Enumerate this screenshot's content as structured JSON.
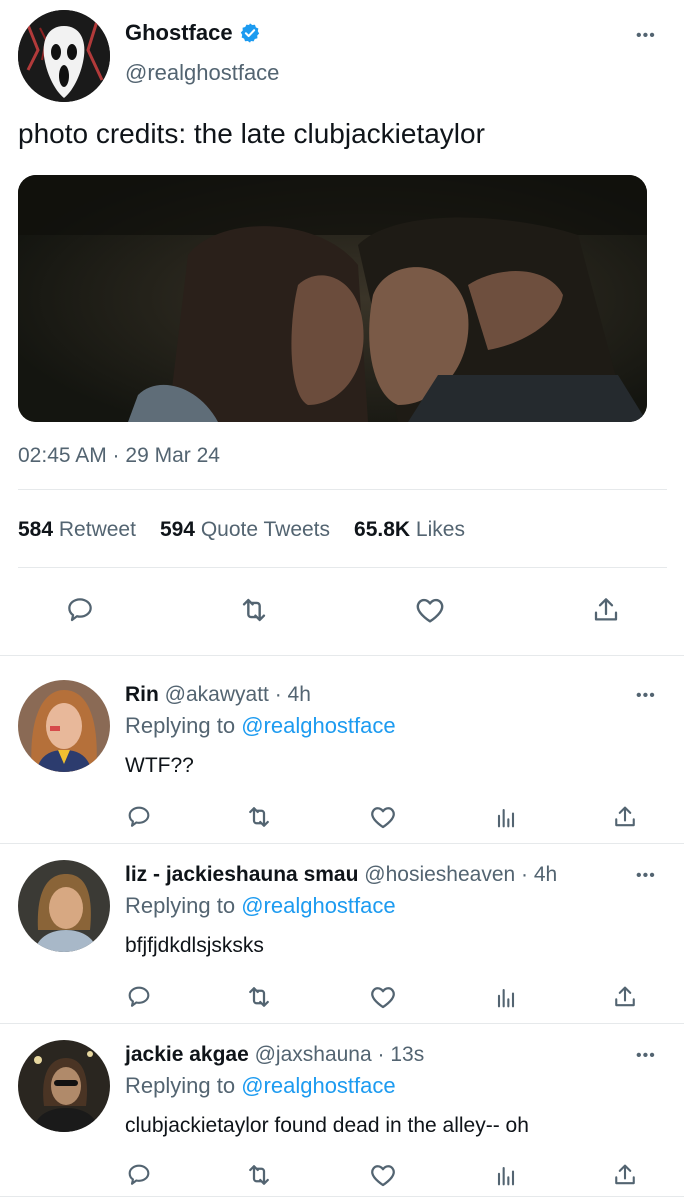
{
  "main_tweet": {
    "author_name": "Ghostface",
    "handle": "@realghostface",
    "text": "photo credits: the late clubjackietaylor",
    "timestamp": "02:45 AM · 29 Mar 24",
    "stats": {
      "retweets_count": "584",
      "retweets_label": "Retweet",
      "quotes_count": "594",
      "quotes_label": "Quote Tweets",
      "likes_count": "65.8K",
      "likes_label": "Likes"
    },
    "actions": [
      "reply-icon",
      "retweet-icon",
      "like-icon",
      "share-icon"
    ]
  },
  "replies": [
    {
      "name": "Rin",
      "handle": "@akawyatt",
      "time": "· 4h",
      "replying_prefix": "Replying to",
      "replying_handle": "@realghostface",
      "text": "WTF??"
    },
    {
      "name": "liz - jackieshauna smau",
      "handle": "@hosiesheaven",
      "time": "· 4h",
      "replying_prefix": "Replying to",
      "replying_handle": "@realghostface",
      "text": "bfjfjdkdlsjsksks"
    },
    {
      "name": "jackie akgae",
      "handle": "@jaxshauna",
      "time": "· 13s",
      "replying_prefix": "Replying to",
      "replying_handle": "@realghostface",
      "text": "clubjackietaylor found dead in the alley-- oh"
    }
  ],
  "reply_actions": [
    "reply-icon",
    "retweet-icon",
    "like-icon",
    "views-icon",
    "share-icon"
  ],
  "colors": {
    "accent": "#1d9bf0",
    "text": "#0f1419",
    "muted": "#536471",
    "divider": "#e6e9eb"
  },
  "more_menu_glyph": "•••"
}
